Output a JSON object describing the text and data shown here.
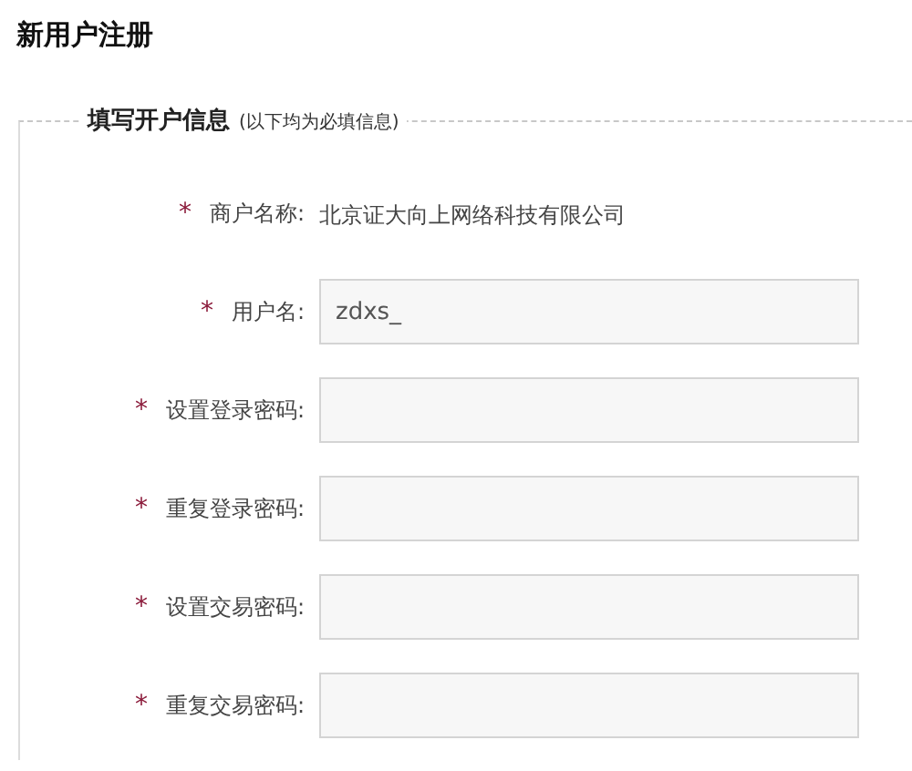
{
  "page_title": "新用户注册",
  "section": {
    "title": "填写开户信息",
    "note": "(以下均为必填信息)"
  },
  "fields": [
    {
      "kind": "text",
      "mark": "*",
      "label": "商户名称:",
      "value": "北京证大向上网络科技有限公司"
    },
    {
      "kind": "input",
      "mark": "*",
      "label": "用户名:",
      "value": "zdxs_"
    },
    {
      "kind": "input",
      "mark": "*",
      "label": "设置登录密码:"
    },
    {
      "kind": "input",
      "mark": "*",
      "label": "重复登录密码:"
    },
    {
      "kind": "input",
      "mark": "*",
      "label": "设置交易密码:"
    },
    {
      "kind": "input",
      "mark": "*",
      "label": "重复交易密码:"
    }
  ]
}
